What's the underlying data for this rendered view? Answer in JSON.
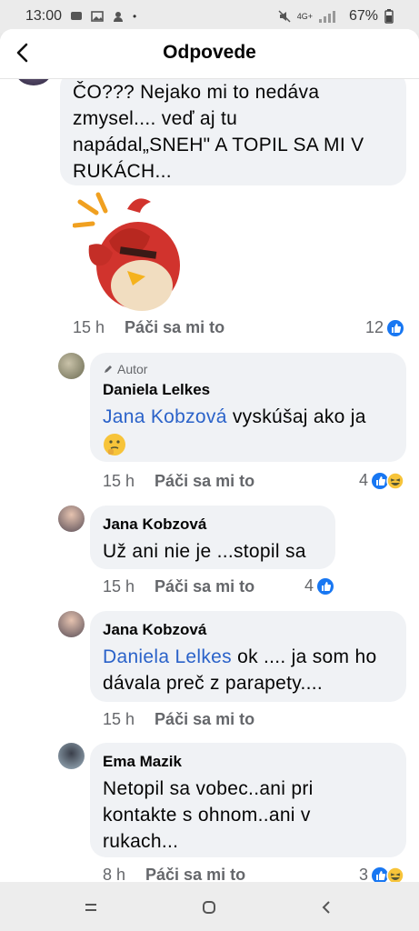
{
  "status": {
    "time": "13:00",
    "battery": "67%",
    "network": "4G+"
  },
  "header": {
    "title": "Odpovede"
  },
  "comments": [
    {
      "text": "ČO??? Nejako mi to nedáva zmysel.... veď aj tu napádal„SNEH\" A TOPIL SA MI V RUKÁCH...",
      "line1": "ČO??? Nejako mi to nedáva",
      "line2": "zmysel.... veď aj tu",
      "line3": "napádal„SNEH\" A TOPIL SA MI V",
      "line4": "RUKÁCH...",
      "time": "15 h",
      "like": "Páči sa mi to",
      "reactions": "12"
    },
    {
      "badge": "Autor",
      "name": "Daniela Lelkes",
      "mention": "Jana Kobzová",
      "text_rest": " vyskúšaj ako ja",
      "time": "15 h",
      "like": "Páči sa mi to",
      "reactions": "4"
    },
    {
      "name": "Jana Kobzová",
      "text": "Už ani nie je ...stopil sa",
      "time": "15 h",
      "like": "Páči sa mi to",
      "reactions": "4"
    },
    {
      "name": "Jana Kobzová",
      "mention": "Daniela Lelkes",
      "text_rest": " ok .... ja som ho",
      "line2": "dávala preč z parapety....",
      "time": "15 h",
      "like": "Páči sa mi to"
    },
    {
      "name": "Ema Mazik",
      "line1": "Netopil sa vobec..ani pri",
      "line2": "kontakte s ohnom..ani v",
      "line3": "rukach...",
      "time": "8 h",
      "like": "Páči sa mi to",
      "reactions": "3"
    }
  ],
  "icons": {
    "back": "back-arrow-icon",
    "like": "like-reaction-icon",
    "haha": "haha-reaction-icon",
    "pencil": "pencil-icon",
    "think": "thinking-emoji-icon"
  },
  "colors": {
    "accent": "#1877f2",
    "mention": "#2a62c9",
    "bubble": "#f0f2f5",
    "meta": "#65676b"
  }
}
